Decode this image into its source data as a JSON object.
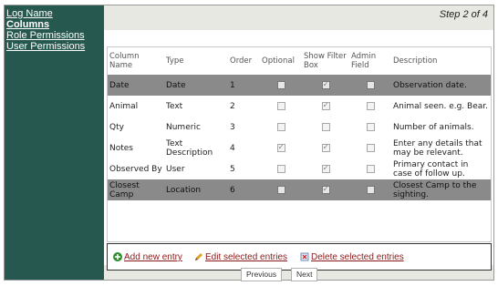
{
  "sidebar": {
    "items": [
      {
        "label": "Log Name",
        "active": false
      },
      {
        "label": "Columns",
        "active": true
      },
      {
        "label": "Role Permissions",
        "active": false
      },
      {
        "label": "User Permissions",
        "active": false
      }
    ]
  },
  "header": {
    "step": "Step 2 of 4"
  },
  "table": {
    "columns": [
      "Column Name",
      "Type",
      "Order",
      "Optional",
      "Show Filter Box",
      "Admin Field",
      "Description"
    ],
    "rows": [
      {
        "name": "Date",
        "type": "Date",
        "order": "1",
        "optional": false,
        "filter": true,
        "admin": false,
        "description": "Observation date.",
        "shade": "dark"
      },
      {
        "name": "Animal",
        "type": "Text",
        "order": "2",
        "optional": false,
        "filter": true,
        "admin": false,
        "description": "Animal seen. e.g. Bear.",
        "shade": "light"
      },
      {
        "name": "Qty",
        "type": "Numeric",
        "order": "3",
        "optional": false,
        "filter": false,
        "admin": false,
        "description": "Number of animals.",
        "shade": "light"
      },
      {
        "name": "Notes",
        "type": "Text Description",
        "order": "4",
        "optional": true,
        "filter": true,
        "admin": false,
        "description": "Enter any details that may be relevant.",
        "shade": "light"
      },
      {
        "name": "Observed By",
        "type": "User",
        "order": "5",
        "optional": false,
        "filter": true,
        "admin": false,
        "description": "Primary contact in case of follow up.",
        "shade": "light"
      },
      {
        "name": "Closest Camp",
        "type": "Location",
        "order": "6",
        "optional": false,
        "filter": true,
        "admin": false,
        "description": "Closest Camp to the sighting.",
        "shade": "dark"
      }
    ]
  },
  "actions": {
    "add": "Add new entry",
    "edit": "Edit selected entries",
    "delete": "Delete selected entries"
  },
  "nav": {
    "previous": "Previous",
    "next": "Next"
  },
  "colors": {
    "sidebar": "#26584f",
    "accent_link": "#8b1a1a",
    "dark_row": "#8a8a8a",
    "panel": "#e8e8e2"
  }
}
